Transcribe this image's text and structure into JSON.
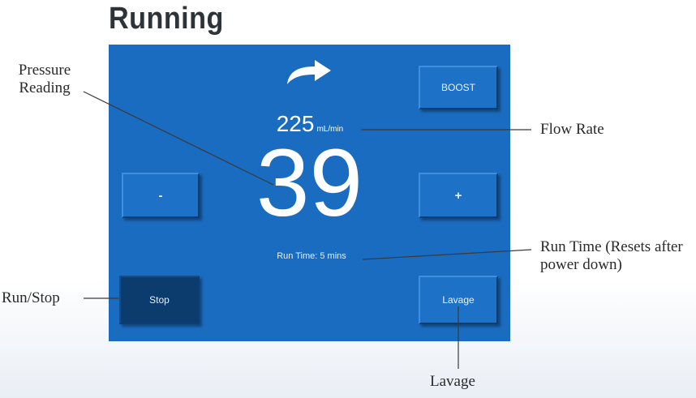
{
  "title": "Running",
  "screen": {
    "boost_label": "BOOST",
    "minus_label": "-",
    "plus_label": "+",
    "stop_label": "Stop",
    "lavage_label": "Lavage",
    "flow_value": "225",
    "flow_unit": "mL/min",
    "pressure_value": "39",
    "run_time_text": "Run Time: 5 mins",
    "colors": {
      "panel": "#1a6cc0",
      "button": "#1d72c8",
      "stop_button": "#0c3b6e"
    },
    "direction_icon": "curved-arrow-right-icon"
  },
  "callouts": {
    "pressure_reading": "Pressure Reading",
    "flow_rate": "Flow Rate",
    "run_time": "Run Time (Resets after power down)",
    "run_stop": "Run/Stop",
    "lavage": "Lavage"
  }
}
